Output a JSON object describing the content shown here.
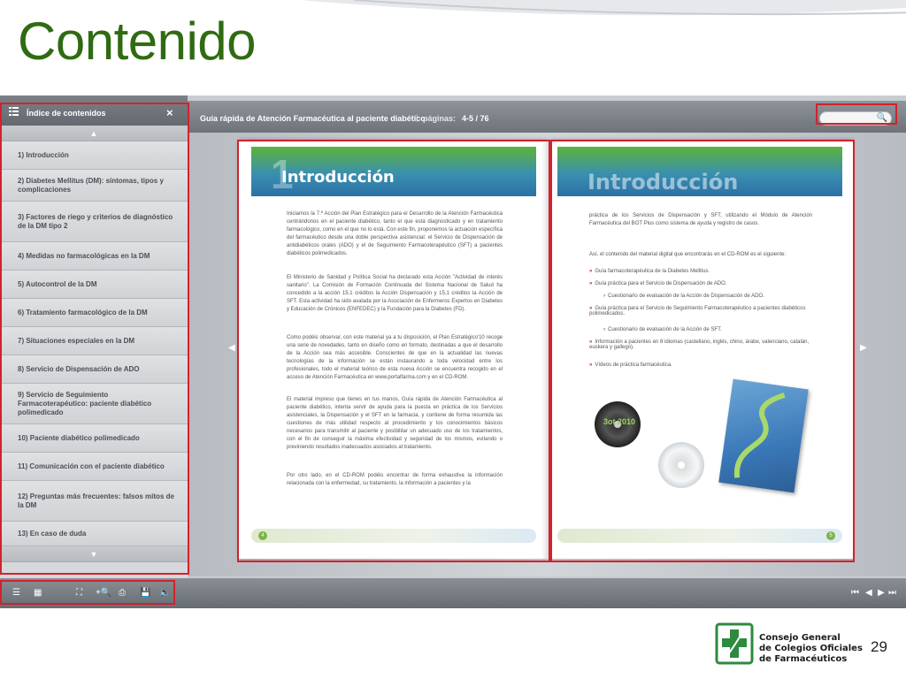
{
  "slide": {
    "title": "Contenido",
    "number": "29"
  },
  "sidebar": {
    "header_label": "Índice de contenidos",
    "close_label": "×",
    "items": [
      "1) Introducción",
      "2) Diabetes Mellitus (DM): síntomas, tipos y complicaciones",
      "3) Factores de riego y criterios de diagnóstico de la DM tipo 2",
      "4) Medidas no farmacológicas en la DM",
      "5) Autocontrol de la DM",
      "6) Tratamiento farmacológico de la DM",
      "7) Situaciones especiales en la DM",
      "8) Servicio de Dispensación de ADO",
      "9) Servicio de Seguimiento Farmacoterapéutico: paciente diabético polimedicado",
      "10) Paciente diabético polimedicado",
      "11) Comunicación con el paciente diabético",
      "12) Preguntas más frecuentes: falsos mitos de la DM",
      "13) En caso de duda"
    ]
  },
  "topbar": {
    "book_title": "Guía rápida de Atención Farmacéutica al paciente diabético",
    "separator": "|",
    "pages_label": "páginas:",
    "pages_value": "4-5  /  76"
  },
  "left_page": {
    "chapter_number": "1",
    "heading": "Introducción",
    "paragraphs": [
      "Iniciamos la 7.ª Acción del Plan Estratégico para el Desarrollo de la Atención Farmacéutica centrándonos en el paciente diabético, tanto el que está diagnosticado y en tratamiento farmacológico, como en el que no lo está. Con este fin, proponemos la actuación específica del farmacéutico desde una doble perspectiva asistencial: el Servicio de Dispensación de antidiabéticos orales (ADO) y el de Seguimiento Farmacoterapéutico (SFT) a pacientes diabéticos polimedicados.",
      "El Ministerio de Sanidad y Política Social ha declarado esta Acción \"Actividad de interés sanitario\". La Comisión de Formación Continuada del Sistema Nacional de Salud ha concedido a la acción 15,1 créditos la Acción Dispensación y 15,1 créditos la Acción de SFT. Esta actividad ha sido avalada por la Asociación de Enfermeros Expertos en Diabetes y Educación de Crónicos (ENFEDEC) y la Fundación para la Diabetes (FD).",
      "Como podéis observar, con este material ya a tu disposición, el Plan Estratégico'10 recoge una serie de novedades, tanto en diseño como en formato, destinadas a que el desarrollo de la Acción sea más accesible. Conscientes de que en la actualidad las nuevas tecnologías de la información se están instaurando a toda velocidad entre los profesionales, todo el material teórico de esta nueva Acción se encuentra recogido en el acceso de Atención Farmacéutica en www.portalfarma.com y en el CD-ROM.",
      "El material impreso que tienes en tus manos, Guía rápida de Atención Farmacéutica al paciente diabético, intenta servir de ayuda para la puesta en práctica de los Servicios asistenciales, la Dispensación y el SFT en la farmacia, y contiene de forma resumida las cuestiones de más utilidad respecto al procedimiento y los conocimientos básicos necesarios para transmitir al paciente y posibilitar un adecuado uso de los tratamientos, con el fin de conseguir la máxima efectividad y seguridad de los mismos, evitando o previniendo resultados inadecuados asociados al tratamiento.",
      "Por otro lado, en el CD-ROM podéis encontrar de forma exhaustiva la información relacionada con la enfermedad, su tratamiento, la información a pacientes y la"
    ],
    "page_number": "4"
  },
  "right_page": {
    "heading": "Introducción",
    "intro": "práctica de los Servicios de Dispensación y SFT, utilizando el Módulo de Atención Farmacéutica del BOT Plus como sistema de ayuda y registro de casos.",
    "lead": "Así, el contenido del material digital que encontrarás en el CD-ROM es el siguiente:",
    "bullets": [
      {
        "text": "Guía farmacoterapéutica de la Diabetes Mellitus.",
        "sub": false
      },
      {
        "text": "Guía práctica para el Servicio de Dispensación de ADO.",
        "sub": false
      },
      {
        "text": "Cuestionario de evaluación de la Acción de Dispensación de ADO.",
        "sub": true
      },
      {
        "text": "Guía práctica para el Servicio de Seguimiento Farmacoterapéutico a pacientes diabéticos polimedicados.",
        "sub": false
      },
      {
        "text": "Cuestionario de evaluación de la Acción de SFT.",
        "sub": true
      },
      {
        "text": "Información a pacientes en 8 idiomas (castellano, inglés, chino, árabe, valenciano, catalán, euskera y gallego).",
        "sub": false
      },
      {
        "text": "Vídeos de práctica farmacéutica.",
        "sub": false
      }
    ],
    "cd_label": "3ot 2010",
    "page_number": "5"
  },
  "footer": {
    "logo_lines": [
      "Consejo General",
      "de Colegios Oficiales",
      "de Farmacéuticos"
    ]
  },
  "colors": {
    "title_green": "#2f6b12",
    "highlight_red": "#d2222c",
    "banner_green": "#5cb338",
    "banner_blue": "#2c70a6"
  }
}
